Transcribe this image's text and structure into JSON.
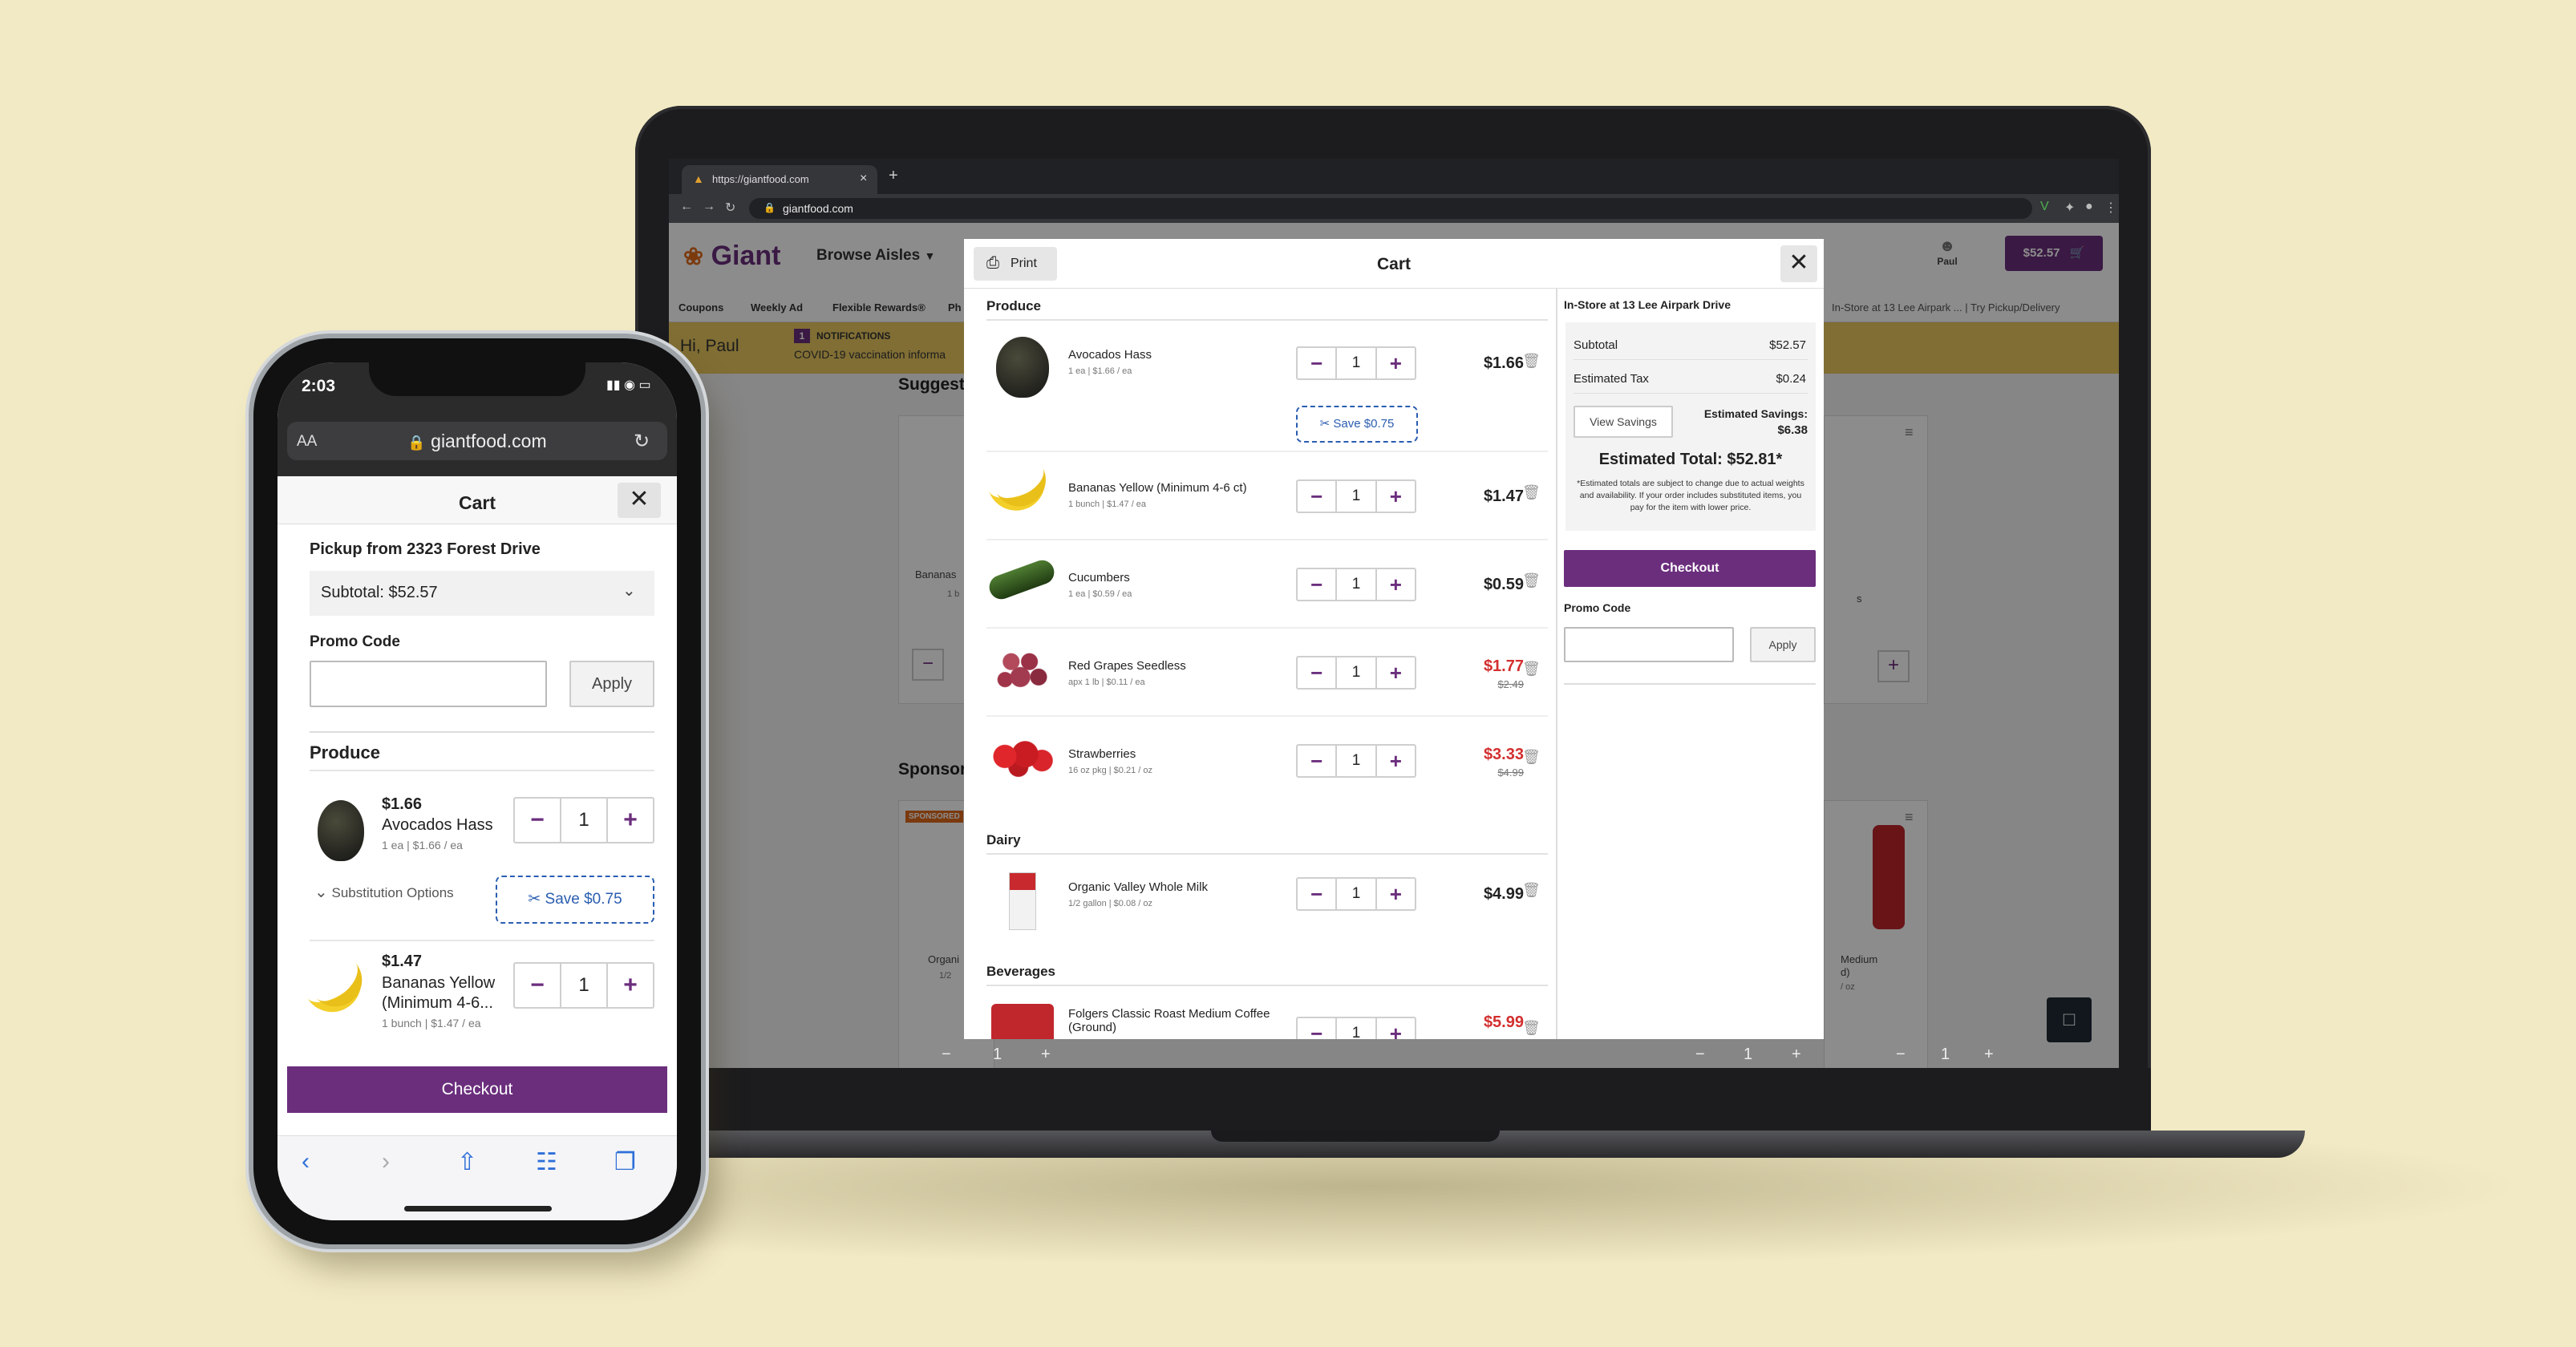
{
  "laptop": {
    "browser": {
      "tab_title": "https://giantfood.com",
      "tab_close": "×",
      "new_tab": "+",
      "url": "giantfood.com"
    },
    "site": {
      "logo": "Giant",
      "browse_aisles": "Browse Aisles",
      "account_label": "Paul",
      "cart_total": "$52.57",
      "nav": [
        "Coupons",
        "Weekly Ad",
        "Flexible Rewards®",
        "Ph"
      ],
      "store_info": {
        "label": "In-Store",
        "at": "at",
        "location": "13 Lee Airpark ...",
        "sep": "|",
        "alt": "Try Pickup/Delivery"
      },
      "greeting": "Hi, Paul",
      "notifications_count": "1",
      "notifications_label": "NOTIFICATIONS",
      "notice_text": "COVID-19 vaccination informa",
      "suggested_heading": "Suggest",
      "sponsored_heading": "Sponsor",
      "bg_cards": {
        "left_card_name": "Bananas",
        "left_card_sub": "1 b",
        "sponsored_badge": "SPONSORED",
        "left_card2_name": "Organi",
        "left_card2_sub": "1/2",
        "right_card_text1": "s",
        "right_card2_name": "Medium",
        "right_card2_line2": "d)",
        "right_card2_sub": "/ oz",
        "stepper_minus": "−",
        "stepper_plus": "+",
        "stepper_value": "1"
      }
    },
    "modal": {
      "print_label": "Print",
      "title": "Cart",
      "close": "✕",
      "sections": {
        "produce": "Produce",
        "dairy": "Dairy",
        "beverages": "Beverages"
      },
      "items": [
        {
          "name": "Avocados Hass",
          "sub": "1 ea | $1.66 / ea",
          "qty": "1",
          "price": "$1.66",
          "old": "",
          "coupon": "Save $0.75"
        },
        {
          "name": "Bananas Yellow (Minimum 4-6 ct)",
          "sub": "1 bunch | $1.47 / ea",
          "qty": "1",
          "price": "$1.47",
          "old": ""
        },
        {
          "name": "Cucumbers",
          "sub": "1 ea | $0.59 / ea",
          "qty": "1",
          "price": "$0.59",
          "old": ""
        },
        {
          "name": "Red Grapes Seedless",
          "sub": "apx 1 lb | $0.11 / ea",
          "qty": "1",
          "price": "$1.77",
          "old": "$2.49"
        },
        {
          "name": "Strawberries",
          "sub": "16 oz pkg | $0.21 / oz",
          "qty": "1",
          "price": "$3.33",
          "old": "$4.99"
        },
        {
          "name": "Organic Valley Whole Milk",
          "sub": "1/2 gallon | $0.08 / oz",
          "qty": "1",
          "price": "$4.99",
          "old": ""
        },
        {
          "name": "Folgers Classic Roast Medium Coffee (Ground)",
          "sub": "",
          "qty": "1",
          "price": "$5.99",
          "old": ""
        }
      ],
      "qty_minus": "−",
      "qty_plus": "+",
      "summary": {
        "store": "In-Store at 13 Lee Airpark Drive",
        "subtotal_label": "Subtotal",
        "subtotal": "$52.57",
        "tax_label": "Estimated Tax",
        "tax": "$0.24",
        "view_savings": "View Savings",
        "savings_label": "Estimated Savings:",
        "savings": "$6.38",
        "total": "Estimated Total: $52.81*",
        "disclaimer": "*Estimated totals are subject to change due to actual weights and availability. If your order includes substituted items, you pay for the item with lower price.",
        "checkout": "Checkout",
        "promo_label": "Promo Code",
        "apply": "Apply"
      }
    }
  },
  "phone": {
    "time": "2:03",
    "aa": "AA",
    "url": "giantfood.com",
    "cart_title": "Cart",
    "close": "✕",
    "pickup": "Pickup from 2323 Forest Drive",
    "subtotal": "Subtotal: $52.57",
    "promo_label": "Promo Code",
    "apply": "Apply",
    "produce": "Produce",
    "items": [
      {
        "price": "$1.66",
        "name": "Avocados Hass",
        "sub": "1 ea | $1.66 / ea",
        "qty": "1"
      },
      {
        "price": "$1.47",
        "name": "Bananas Yellow (Minimum 4-6...",
        "sub": "1 bunch | $1.47 / ea",
        "qty": "1"
      }
    ],
    "substitution": "Substitution Options",
    "save_coupon": "Save $0.75",
    "qty_minus": "−",
    "qty_plus": "+",
    "checkout": "Checkout"
  }
}
